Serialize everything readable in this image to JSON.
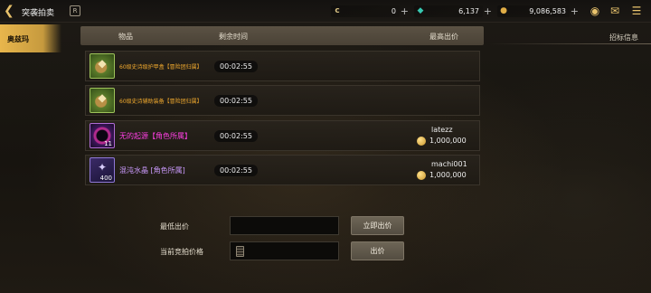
{
  "header": {
    "title": "突袭拍卖",
    "book_icon": "R"
  },
  "currencies": [
    {
      "icon": "c",
      "value": "0",
      "plus": "+"
    },
    {
      "icon": "◆",
      "value": "6,137",
      "plus": "+"
    },
    {
      "icon": "●",
      "value": "9,086,583",
      "plus": "+"
    }
  ],
  "sidebar": {
    "active_tab": "奥兹玛"
  },
  "table": {
    "columns": [
      "物品",
      "剩余时间",
      "最高出价"
    ],
    "bid_info_label": "招标信息",
    "rows": [
      {
        "name": "60级史诗级护甲盒【冒险团归属】",
        "time": "00:02:55",
        "bidder": "",
        "price": "",
        "icon": "green-chest-icon",
        "qty": ""
      },
      {
        "name": "60级史诗辅助装备【冒险团归属】",
        "time": "00:02:55",
        "bidder": "",
        "price": "",
        "icon": "green-chest-icon",
        "qty": ""
      },
      {
        "name": "无的起源【角色所属】",
        "time": "00:02:55",
        "bidder": "latezz",
        "price": "1,000,000",
        "icon": "purple-orb-icon",
        "qty": "11"
      },
      {
        "name": "混沌水晶 [角色所属]",
        "time": "00:02:55",
        "bidder": "machi001",
        "price": "1,000,000",
        "icon": "crystal-icon",
        "qty": "400"
      }
    ]
  },
  "form": {
    "min_bid_label": "最低出价",
    "min_bid_value": "",
    "buy_now_button": "立即出价",
    "current_price_label": "当前竞拍价格",
    "current_price_value": "",
    "bid_button": "出价"
  },
  "colors": {
    "accent_gold": "#e8b64c",
    "orange_item": "#f0a92e",
    "magenta_item": "#ff3fe4",
    "lilac_item": "#cc9bff"
  }
}
